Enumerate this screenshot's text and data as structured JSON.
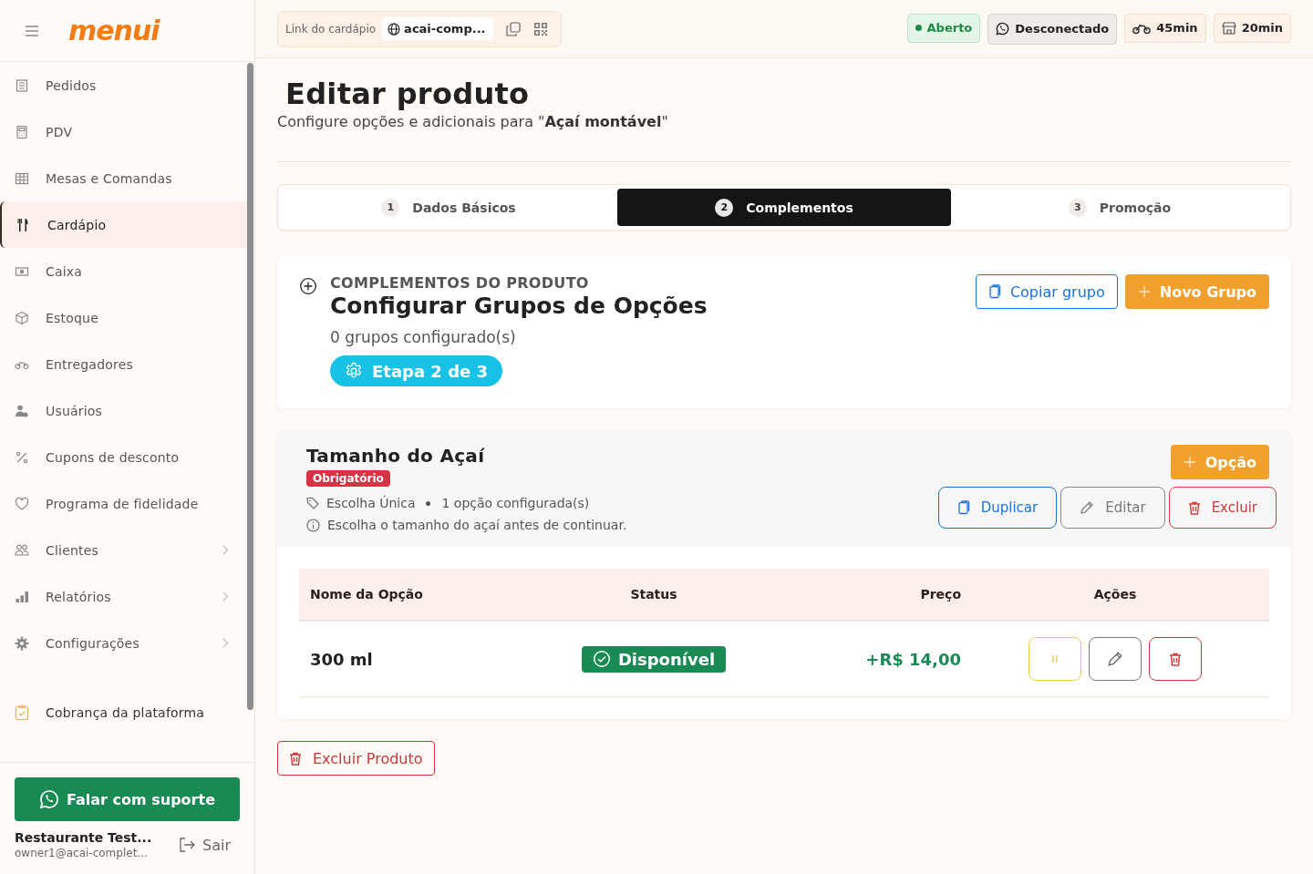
{
  "sidebar": {
    "logo": "menui",
    "items": [
      {
        "label": "Pedidos",
        "selected": false,
        "expandable": false
      },
      {
        "label": "PDV",
        "selected": false,
        "expandable": false
      },
      {
        "label": "Mesas e Comandas",
        "selected": false,
        "expandable": false
      },
      {
        "label": "Cardápio",
        "selected": true,
        "expandable": false
      },
      {
        "label": "Caixa",
        "selected": false,
        "expandable": false
      },
      {
        "label": "Estoque",
        "selected": false,
        "expandable": false
      },
      {
        "label": "Entregadores",
        "selected": false,
        "expandable": false
      },
      {
        "label": "Usuários",
        "selected": false,
        "expandable": false
      },
      {
        "label": "Cupons de desconto",
        "selected": false,
        "expandable": false
      },
      {
        "label": "Programa de fidelidade",
        "selected": false,
        "expandable": false
      },
      {
        "label": "Clientes",
        "selected": false,
        "expandable": true
      },
      {
        "label": "Relatórios",
        "selected": false,
        "expandable": true
      },
      {
        "label": "Configurações",
        "selected": false,
        "expandable": true
      }
    ],
    "extra_items": [
      {
        "label": "Cobrança da plataforma"
      }
    ],
    "support_button": "Falar com suporte",
    "user": {
      "name": "Restaurante Test...",
      "email": "owner1@acai-complet..."
    },
    "logout": "Sair"
  },
  "topbar": {
    "link_label": "Link do cardápio",
    "link_value": "acai-comp...",
    "badges": [
      {
        "kind": "status",
        "label": "Aberto"
      },
      {
        "kind": "whatsapp",
        "label": "Desconectado"
      },
      {
        "kind": "delivery",
        "label": "45min"
      },
      {
        "kind": "pickup",
        "label": "20min"
      }
    ]
  },
  "page": {
    "title": "Editar produto",
    "subtitle": "Configure opções e adicionais para \"**Açaí montável**\""
  },
  "steps": [
    {
      "number": "1",
      "label": "Dados Básicos",
      "selected": false
    },
    {
      "number": "2",
      "label": "Complementos",
      "selected": true
    },
    {
      "number": "3",
      "label": "Promoção",
      "selected": false
    }
  ],
  "section": {
    "eyebrow": "COMPLEMENTOS DO PRODUTO",
    "title": "Configurar Grupos de Opções",
    "count": "0 grupos configurado(s)",
    "step_badge": "Etapa 2 de 3",
    "copy_button": "Copiar grupo",
    "new_button": "Novo Grupo"
  },
  "group": {
    "title": "Tamanho do Açaí",
    "required_badge": "Obrigatório",
    "type": "Escolha Única",
    "options_count": "1 opção configurada(s)",
    "hint": "Escolha o tamanho do açaí antes de continuar.",
    "add_button": "Opção",
    "actions": [
      {
        "kind": "duplicate",
        "label": "Duplicar"
      },
      {
        "kind": "edit",
        "label": "Editar"
      },
      {
        "kind": "delete",
        "label": "Excluir"
      }
    ],
    "table": {
      "columns": [
        "Nome da Opção",
        "Status",
        "Preço",
        "Ações"
      ],
      "rows": [
        {
          "name": "300 ml",
          "status": "Disponível",
          "price": "+R$ 14,00"
        }
      ]
    }
  },
  "delete_product": "Excluir Produto"
}
